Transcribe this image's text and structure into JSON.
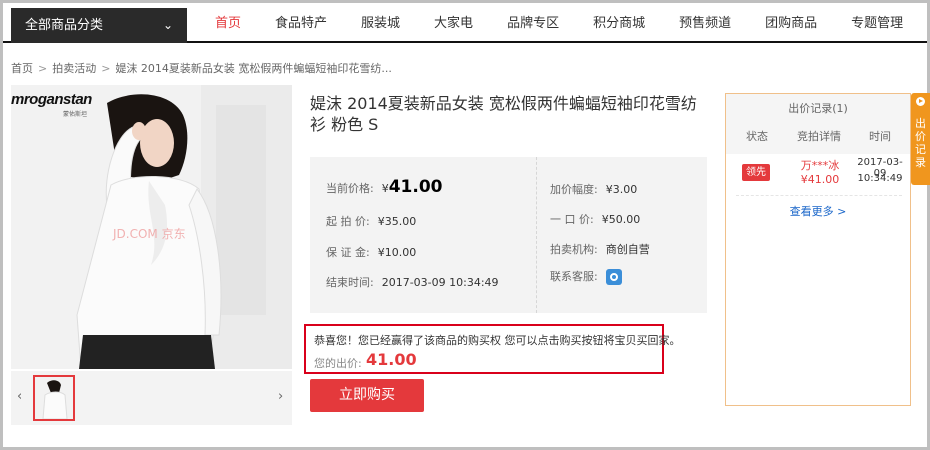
{
  "nav": {
    "all_categories": "全部商品分类",
    "items": [
      "首页",
      "食品特产",
      "服装城",
      "大家电",
      "品牌专区",
      "积分商城",
      "预售频道",
      "团购商品",
      "专题管理"
    ]
  },
  "breadcrumb": [
    "首页",
    "拍卖活动",
    "媞沫 2014夏装新品女装 宽松假两件蝙蝠短袖印花雪纺..."
  ],
  "product": {
    "brand_logo": "mroganstan",
    "brand_sub": "蒙佑斯坦",
    "watermark": "JD.COM 京东",
    "title": "媞沫 2014夏装新品女装 宽松假两件蝙蝠短袖印花雪纺衫 粉色 S"
  },
  "info": {
    "current_price_label": "当前价格:",
    "current_price_yen": "¥",
    "current_price": "41.00",
    "start_price_label": "起 拍 价:",
    "start_price": "¥35.00",
    "deposit_label": "保 证 金:",
    "deposit": "¥10.00",
    "end_time_label": "结束时间:",
    "end_time": "2017-03-09 10:34:49",
    "increment_label": "加价幅度:",
    "increment": "¥3.00",
    "buyout_label": "一 口 价:",
    "buyout": "¥50.00",
    "org_label": "拍卖机构:",
    "org": "商创自营",
    "cs_label": "联系客服:"
  },
  "congrats": {
    "message": "恭喜您！您已经赢得了该商品的购买权 您可以点击购买按钮将宝贝买回家。",
    "bid_label": "您的出价:",
    "bid_value": "41.00"
  },
  "buy_button": "立即购买",
  "records": {
    "title": "出价记录(1)",
    "cols": [
      "状态",
      "竞拍详情",
      "时间"
    ],
    "rows": [
      {
        "status": "领先",
        "user": "万***冰",
        "amount": "¥41.00",
        "date": "2017-03-09",
        "time": "10:34:49"
      }
    ],
    "more": "查看更多 >"
  },
  "side_tab": {
    "text": "出价记录"
  },
  "colors": {
    "accent": "#e4393c",
    "side_tab": "#f0961e",
    "link": "#1a66c9"
  }
}
